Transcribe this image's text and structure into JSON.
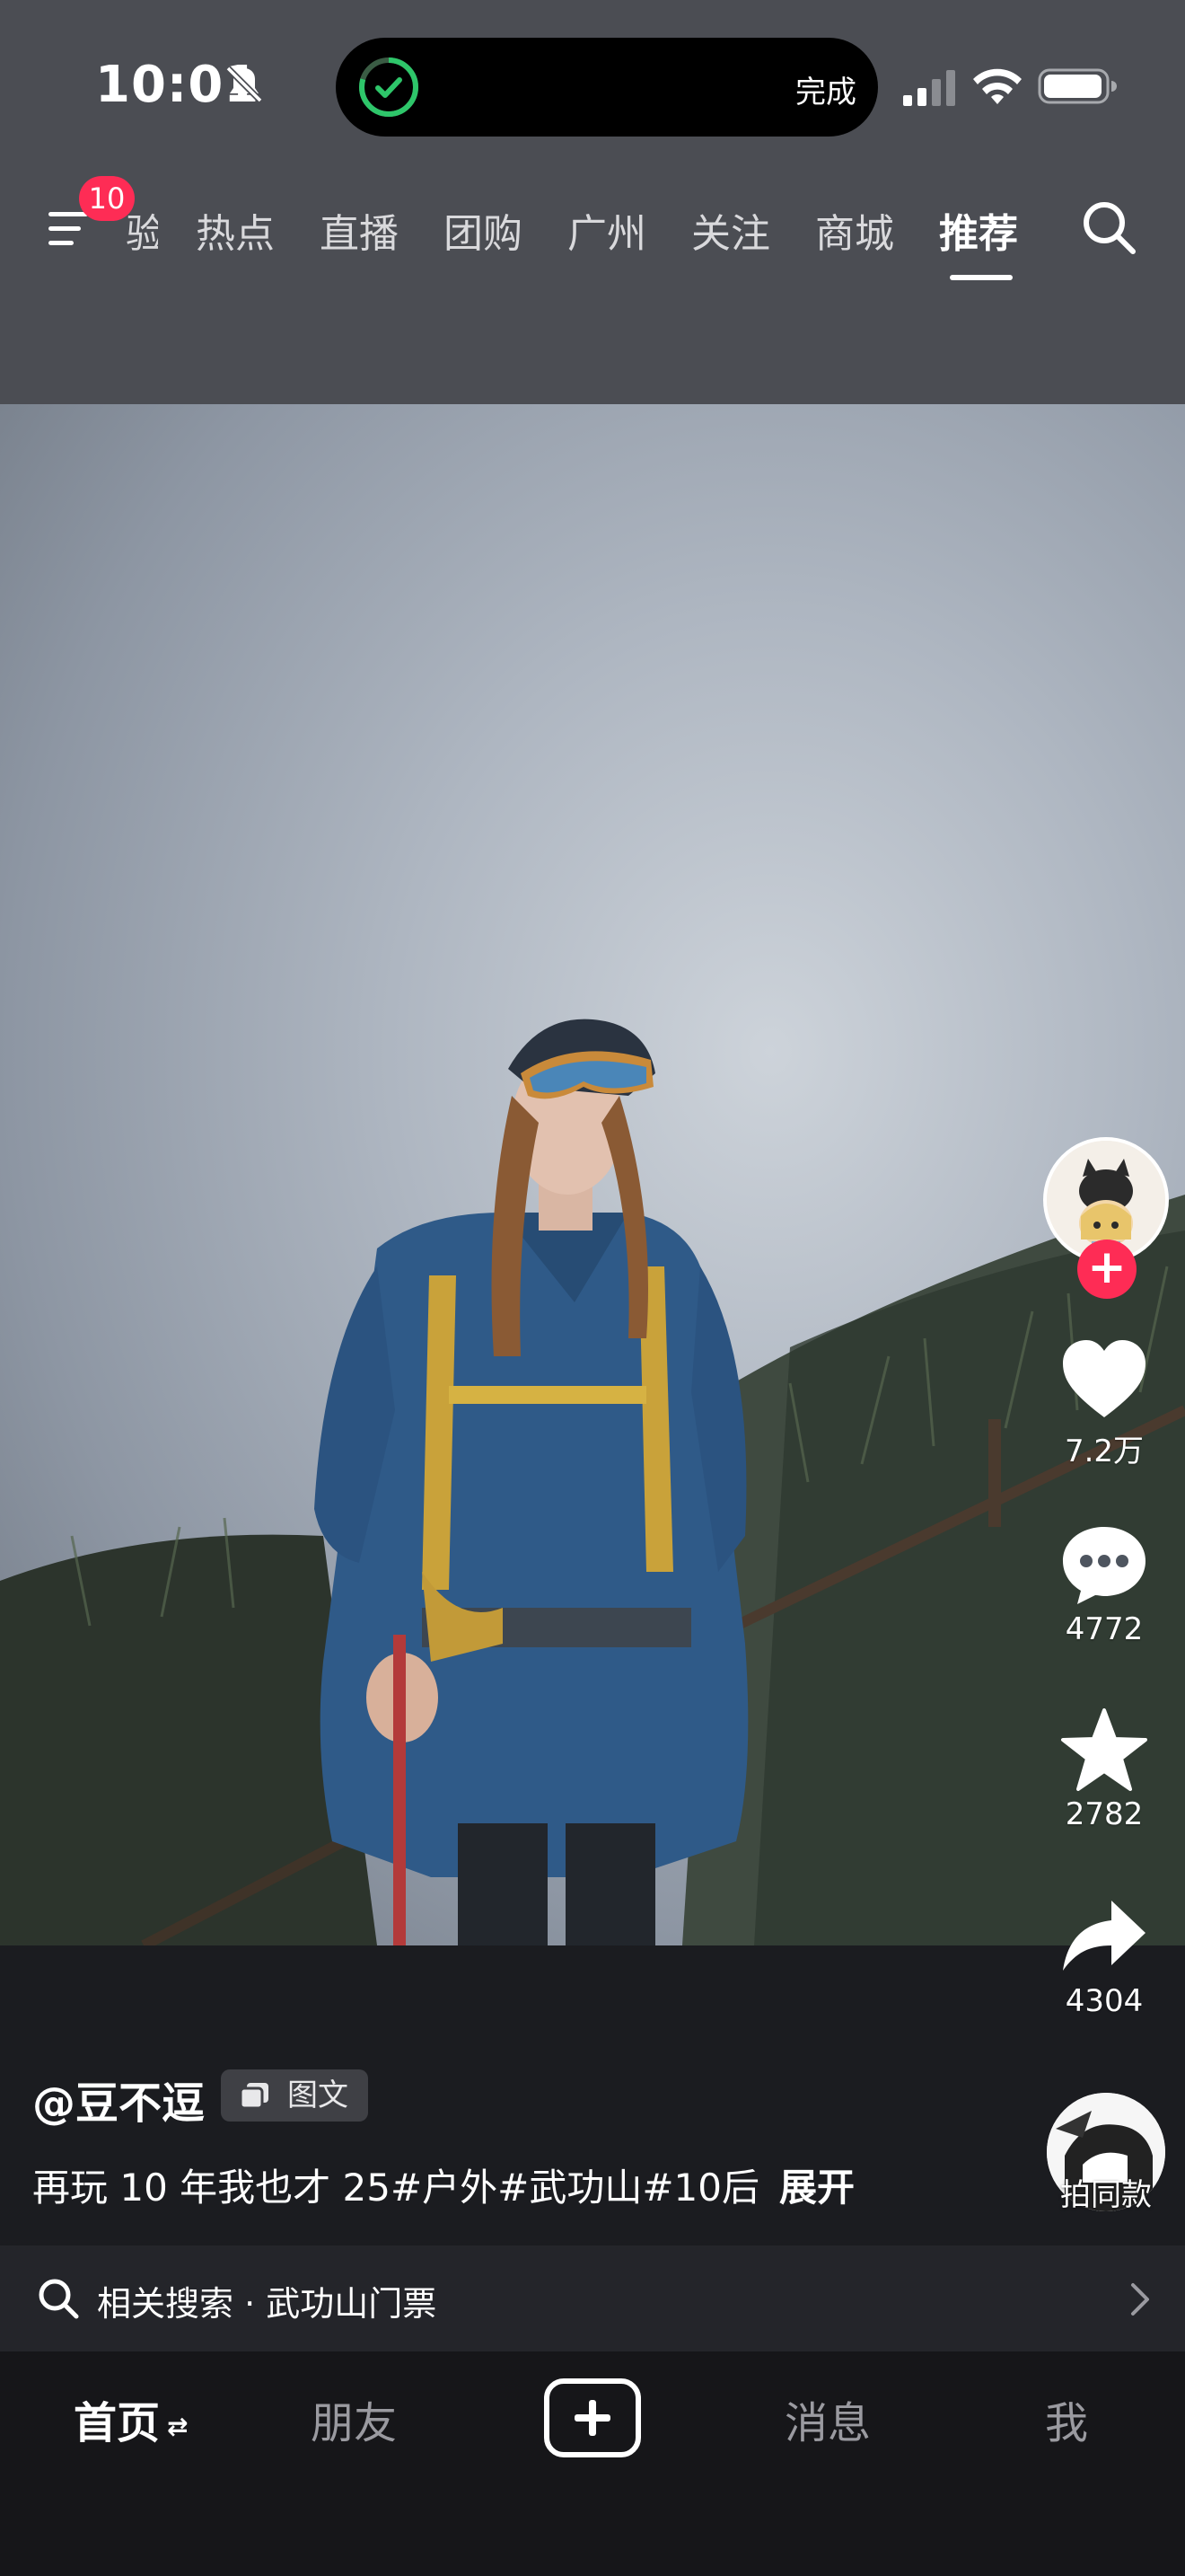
{
  "status_bar": {
    "time": "10:01",
    "island_label": "完成",
    "icons": [
      "bell-muted-icon",
      "check-circle-icon",
      "signal-icon",
      "wifi-icon",
      "battery-icon"
    ]
  },
  "nav": {
    "menu_badge": "10",
    "partial_tab": "验",
    "tabs": [
      "热点",
      "直播",
      "团购",
      "广州",
      "关注",
      "商城",
      "推荐"
    ],
    "active_tab": "推荐"
  },
  "post": {
    "author": "@豆不逗",
    "type_badge": "图文",
    "caption": "再玩 10 年我也才 25#户外#武功山#10后",
    "expand_label": "展开"
  },
  "actions": {
    "likes": "7.2万",
    "comments": "4772",
    "favorites": "2782",
    "shares": "4304",
    "same_style_label": "拍同款"
  },
  "related_search": {
    "text": "相关搜索 · 武功山门票"
  },
  "bottom_nav": {
    "home": "首页",
    "friends": "朋友",
    "messages": "消息",
    "me": "我"
  },
  "colors": {
    "accent": "#fe2c55",
    "top_bg": "#4b4d53",
    "island_check": "#2ec66a"
  }
}
